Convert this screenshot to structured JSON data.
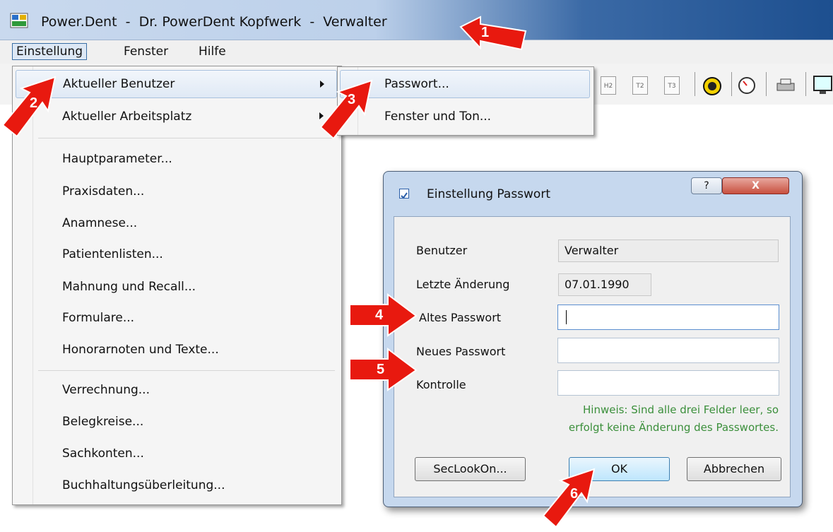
{
  "window": {
    "title": "Power.Dent  -  Dr. PowerDent Kopfwerk  -  Verwalter"
  },
  "menubar": {
    "items": [
      "Einstellung",
      "Fenster",
      "Hilfe"
    ]
  },
  "einstellung_menu": {
    "items": [
      "Aktueller Benutzer",
      "Aktueller Arbeitsplatz",
      "Hauptparameter...",
      "Praxisdaten...",
      "Anamnese...",
      "Patientenlisten...",
      "Mahnung und Recall...",
      "Formulare...",
      "Honorarnoten und Texte...",
      "Verrechnung...",
      "Belegkreise...",
      "Sachkonten...",
      "Buchhaltungsüberleitung..."
    ]
  },
  "benutzer_submenu": {
    "items": [
      "Passwort...",
      "Fenster und Ton..."
    ]
  },
  "toolbar": {
    "icons": [
      "H2",
      "T2",
      "T3"
    ]
  },
  "dialog": {
    "title": "Einstellung Passwort",
    "help_label": "?",
    "close_label": "X",
    "benutzer_label": "Benutzer",
    "benutzer_value": "Verwalter",
    "letzte_label": "Letzte Änderung",
    "letzte_value": "07.01.1990",
    "altes_label": "Altes Passwort",
    "neues_label": "Neues Passwort",
    "kontrolle_label": "Kontrolle",
    "hint_line1": "Hinweis: Sind alle drei Felder leer, so",
    "hint_line2": "erfolgt keine Änderung des Passwortes.",
    "seclook_label": "SecLookOn...",
    "ok_label": "OK",
    "cancel_label": "Abbrechen"
  },
  "callouts": [
    "1",
    "2",
    "3",
    "4",
    "5",
    "6"
  ],
  "colors": {
    "callout_red": "#e8190f",
    "hint_green": "#3b8f3b",
    "dialog_frame": "#c6d8ee"
  }
}
